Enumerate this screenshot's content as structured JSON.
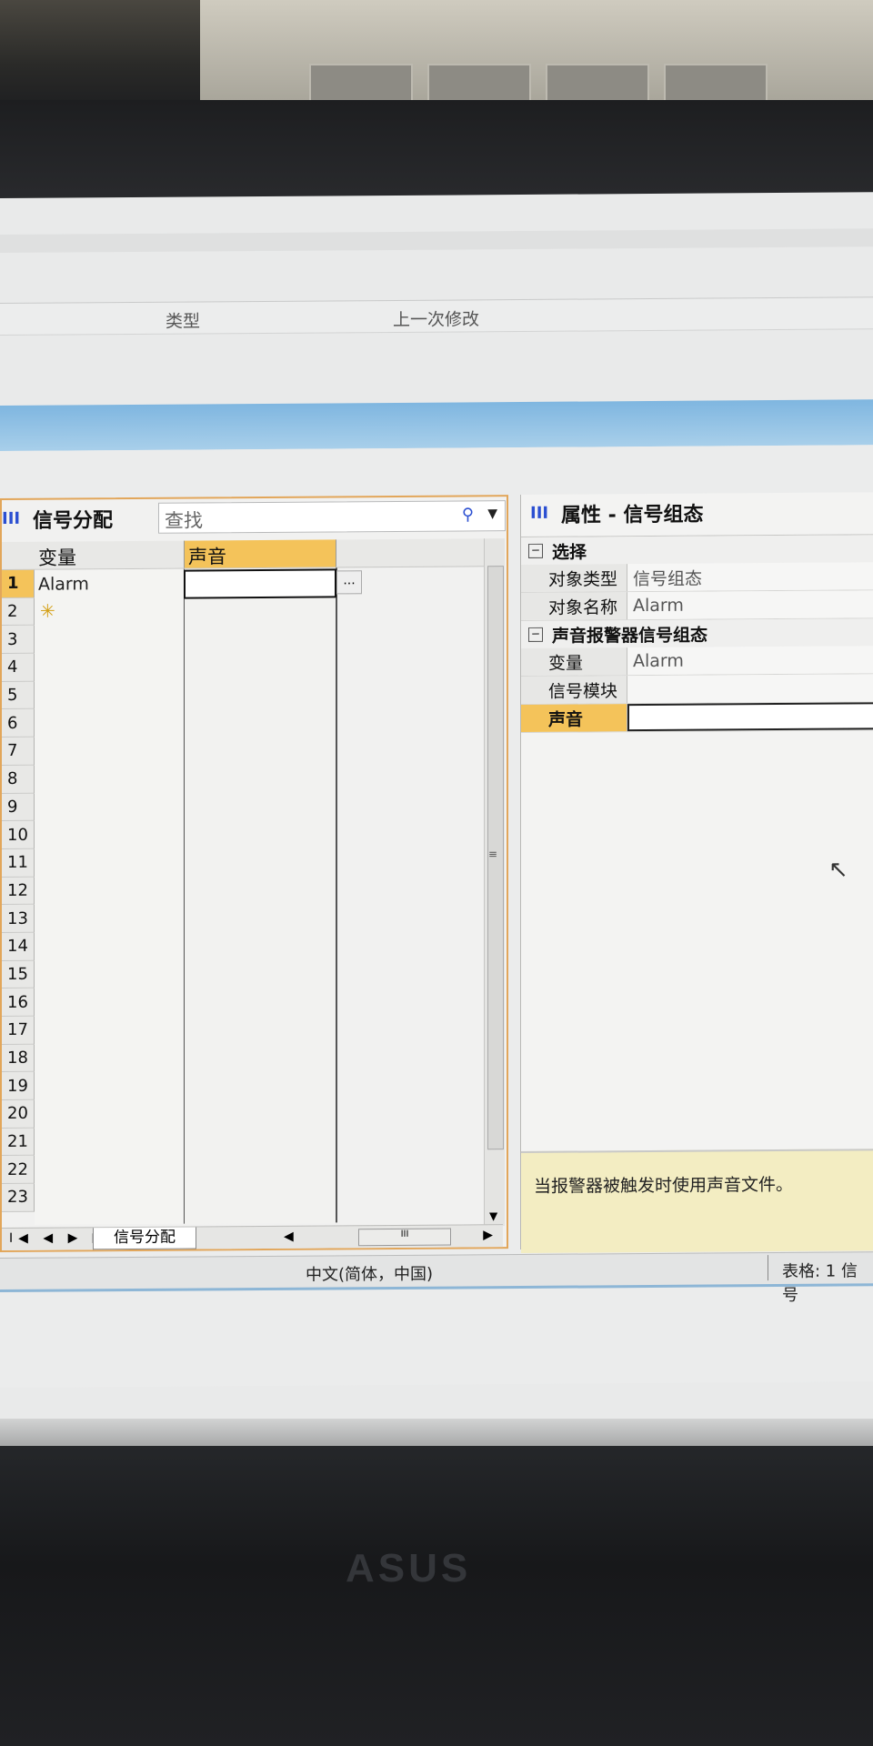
{
  "file_list": {
    "col_type": "类型",
    "col_modified": "上一次修改"
  },
  "left_pane": {
    "title": "信号分配",
    "search_placeholder": "查找",
    "columns": [
      "变量",
      "声音"
    ],
    "rows": [
      {
        "num": "1",
        "variable": "Alarm",
        "sound": ""
      },
      {
        "num": "2"
      },
      {
        "num": "3"
      },
      {
        "num": "4"
      },
      {
        "num": "5"
      },
      {
        "num": "6"
      },
      {
        "num": "7"
      },
      {
        "num": "8"
      },
      {
        "num": "9"
      },
      {
        "num": "10"
      },
      {
        "num": "11"
      },
      {
        "num": "12"
      },
      {
        "num": "13"
      },
      {
        "num": "14"
      },
      {
        "num": "15"
      },
      {
        "num": "16"
      },
      {
        "num": "17"
      },
      {
        "num": "18"
      },
      {
        "num": "19"
      },
      {
        "num": "20"
      },
      {
        "num": "21"
      },
      {
        "num": "22"
      },
      {
        "num": "23"
      }
    ],
    "ellipsis_label": "...",
    "sheet_tab": "信号分配",
    "nav_glyphs": "I◀ ◀ ▶ ▶I",
    "scroll_grip": "III"
  },
  "right_pane": {
    "title": "属性  -  信号组态",
    "sections": [
      {
        "name": "选择",
        "props": [
          {
            "key": "对象类型",
            "value": "信号组态"
          },
          {
            "key": "对象名称",
            "value": "Alarm"
          }
        ]
      },
      {
        "name": "声音报警器信号组态",
        "props": [
          {
            "key": "变量",
            "value": "Alarm"
          },
          {
            "key": "信号模块",
            "value": ""
          },
          {
            "key": "声音",
            "value": ""
          }
        ]
      }
    ],
    "description": "当报警器被触发时使用声音文件。"
  },
  "status_bar": {
    "language": "中文(简体，中国)",
    "table_info": "表格: 1 信号"
  },
  "monitor_logo": "ASUS",
  "colors": {
    "accent": "#f4c35a",
    "pane_border": "#e2a65a",
    "title_band": "#7fb6e0",
    "description_bg": "#f3edc2"
  }
}
